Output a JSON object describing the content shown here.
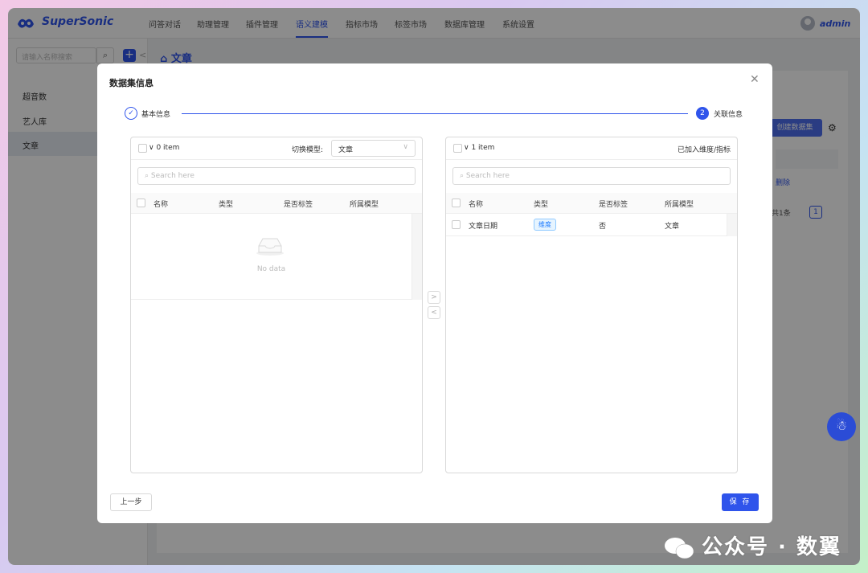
{
  "app": {
    "name": "SuperSonic",
    "user": "admin"
  },
  "nav": [
    "问答对话",
    "助理管理",
    "插件管理",
    "语义建模",
    "指标市场",
    "标签市场",
    "数据库管理",
    "系统设置"
  ],
  "nav_active_index": 3,
  "sidebar": {
    "search_placeholder": "请输入名称搜索",
    "items": [
      {
        "label": "超音数",
        "active": false
      },
      {
        "label": "艺人库",
        "active": false
      },
      {
        "label": "文章",
        "active": true
      }
    ]
  },
  "breadcrumb": "文章",
  "background": {
    "create_button": "创建数据集",
    "delete_link": "删除",
    "total_text": "共1条",
    "page_number": "1"
  },
  "modal": {
    "title": "数据集信息",
    "steps": [
      {
        "index": "1",
        "label": "基本信息",
        "status": "done"
      },
      {
        "index": "2",
        "label": "关联信息",
        "status": "current"
      }
    ],
    "left_panel": {
      "count": "0 item",
      "model_label": "切换模型:",
      "model_value": "文章",
      "search_placeholder": "Search here",
      "columns": [
        "名称",
        "类型",
        "是否标签",
        "所属模型"
      ],
      "empty_text": "No data"
    },
    "right_panel": {
      "count": "1 item",
      "title": "已加入维度/指标",
      "search_placeholder": "Search here",
      "columns": [
        "名称",
        "类型",
        "是否标签",
        "所属模型"
      ],
      "rows": [
        {
          "name": "文章日期",
          "type": "维度",
          "is_tag": "否",
          "model": "文章"
        }
      ]
    },
    "move_right": ">",
    "move_left": "<",
    "prev_button": "上一步",
    "save_button": "保 存"
  },
  "watermark": "公众号 · 数翼"
}
